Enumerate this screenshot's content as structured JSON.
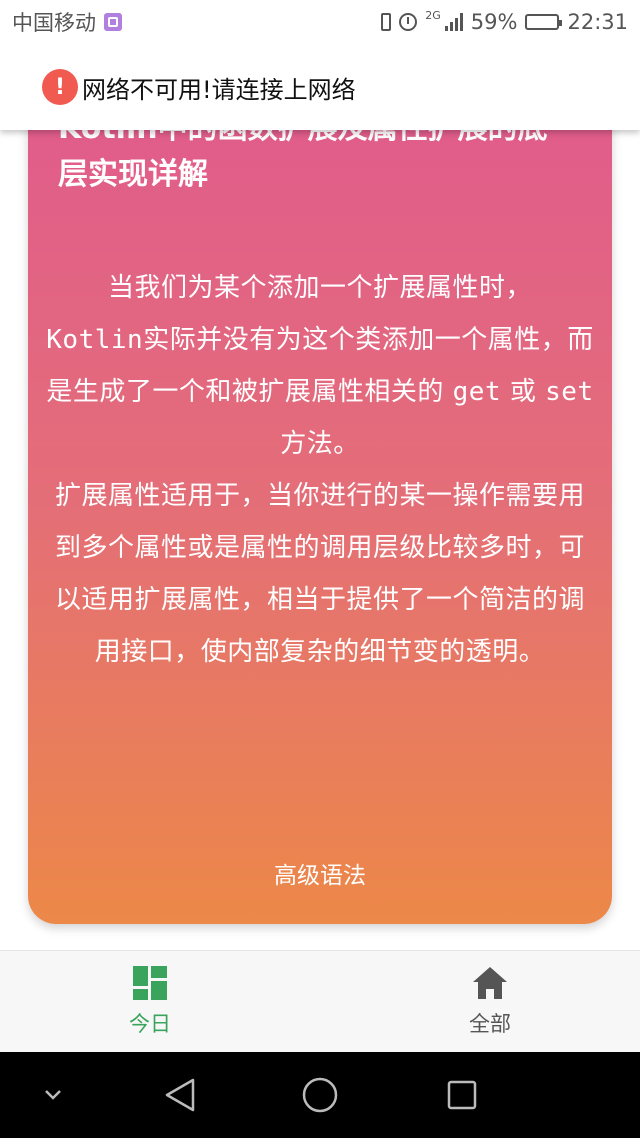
{
  "status_bar": {
    "carrier": "中国移动",
    "network_type": "2G",
    "battery": "59%",
    "battery_level": 0.59,
    "time": "22:31"
  },
  "banner": {
    "icon": "!",
    "message": "网络不可用!请连接上网络"
  },
  "card": {
    "title_line1": "Kotlin中的函数扩展及属性扩展的底",
    "title_line2": "层实现详解",
    "body": [
      {
        "type": "text",
        "value": "当我们为某个添加一个扩展属性时，"
      },
      {
        "type": "br"
      },
      {
        "type": "mono",
        "value": "Kotlin"
      },
      {
        "type": "text",
        "value": "实际并没有为这个类添加一个属性，而是生成了一个和被扩展属性相关的 "
      },
      {
        "type": "mono",
        "value": "get"
      },
      {
        "type": "text",
        "value": " 或 "
      },
      {
        "type": "mono",
        "value": "set"
      },
      {
        "type": "text",
        "value": " 方法。"
      },
      {
        "type": "br"
      },
      {
        "type": "text",
        "value": "扩展属性适用于，当你进行的某一操作需要用到多个属性或是属性的调用层级比较多时，可以适用扩展属性，相当于提供了一个简洁的调用接口，使内部复杂的细节变的透明。"
      }
    ],
    "tag": "高级语法",
    "gradient": {
      "top": "#e05a8e",
      "middle": "#e46e78",
      "bottom": "#ec8848"
    }
  },
  "tabs": [
    {
      "label": "今日",
      "icon": "dashboard-grid-icon",
      "active": true,
      "color": "#3aa45c"
    },
    {
      "label": "全部",
      "icon": "home-icon",
      "active": false,
      "color": "#555555"
    }
  ],
  "nav_bar": {
    "buttons": [
      "chevron-down-icon",
      "back-triangle-icon",
      "home-circle-icon",
      "recents-square-icon"
    ]
  }
}
